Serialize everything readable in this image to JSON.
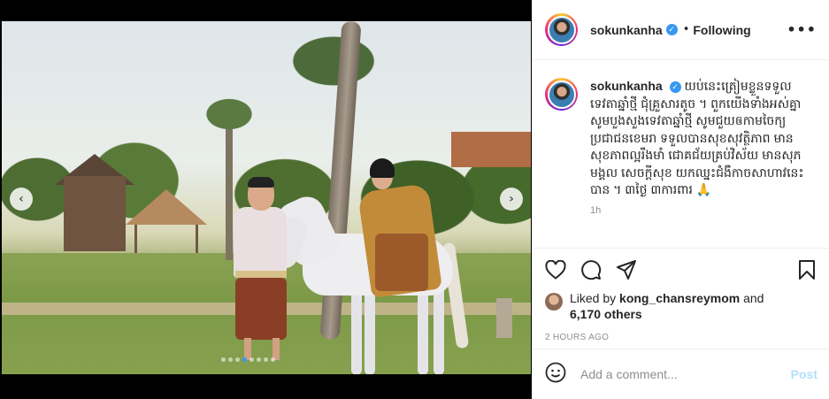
{
  "post": {
    "username": "sokunkanha",
    "follow_status": "Following",
    "separator": "•",
    "more_label": "•••",
    "caption_username": "sokunkanha",
    "caption_text": "យប់នេះត្រៀមខ្លួនទទួលទេវតាឆ្នាំថ្មី ជុំគ្រួសារតូច ។ ពួកយើងទាំងអស់គ្នាសូមបួងសួងទេវតាឆ្នាំថ្មី សូមជួយឲកាមចៃក្យប្រជាជនខេមរា ទទួលបានសុខសុវត្ថិភាព មានសុខភាពល្អរឹងមាំ ជោគជ័យគ្រប់វិស័យ មានសុភមង្គល សេចក្តីសុខ យកឈ្នះជំងឺកាចសាហាវនេះបាន ។ ៣ថ្ងៃ ៣ការពារ 🙏",
    "caption_time": "1h",
    "liked_by_prefix": "Liked by ",
    "liked_by_user": "kong_chansreymom",
    "liked_by_and": " and",
    "likes_count": "6,170 others",
    "timestamp": "2 HOURS AGO",
    "comment_placeholder": "Add a comment...",
    "post_button": "Post",
    "carousel": {
      "total": 8,
      "active": 3
    },
    "nav_prev": "‹",
    "nav_next": "›"
  },
  "icons": {
    "verified": "verified-badge-icon",
    "like": "heart-icon",
    "comment": "comment-bubble-icon",
    "share": "paper-plane-icon",
    "save": "bookmark-icon",
    "emoji": "smiley-icon"
  },
  "colors": {
    "accent": "#3897f0",
    "post_disabled": "#b2dffc",
    "muted": "#8e8e8e",
    "text": "#262626"
  }
}
